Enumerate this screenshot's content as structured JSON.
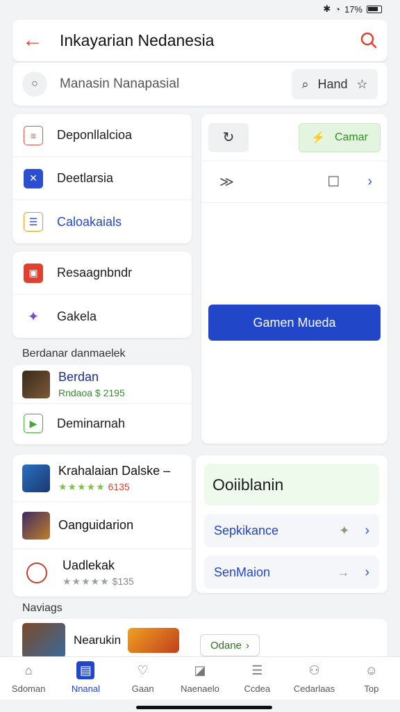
{
  "status": {
    "text": "17%"
  },
  "appbar": {
    "title": "Inkayarian Nedanesia"
  },
  "search": {
    "placeholder": "Manasin Nanapasial",
    "hand_label": "Hand"
  },
  "menu1": [
    {
      "label": "Deponllalcioa",
      "icon": "document-icon",
      "color": "#d9534f"
    },
    {
      "label": "Deetlarsia",
      "icon": "tools-icon",
      "color": "#2b4fd0"
    },
    {
      "label": "Caloakaials",
      "icon": "list-icon",
      "color": "#e0a020"
    }
  ],
  "menu2": [
    {
      "label": "Resaagnbndr",
      "icon": "gift-icon",
      "color": "#e0402f"
    },
    {
      "label": "Gakela",
      "icon": "pin-icon",
      "color": "#7a4fc0"
    }
  ],
  "section1": {
    "label": "Berdanar danmaelek"
  },
  "featured": {
    "name": "Berdan",
    "sub": "Rndaoa $ 2195",
    "link_label": "Deminarnah"
  },
  "apps": [
    {
      "name": "Krahalaian Dalske –",
      "rating_stars": "★★★★★",
      "rating_value": "6135",
      "style": "green",
      "rating": 5
    },
    {
      "name": "Oanguidarion",
      "rating_stars": "",
      "rating_value": "",
      "style": "none"
    },
    {
      "name": "Uadlekak",
      "rating_stars": "★★★★★",
      "rating_value": "$135",
      "style": "gray",
      "rating": 5
    }
  ],
  "right_panel": {
    "camar_label": "Camar",
    "primary_label": "Gamen Mueda"
  },
  "green_card": {
    "title": "Ooiiblanin",
    "rows": [
      {
        "label": "Sepkikance"
      },
      {
        "label": "SenMaion"
      }
    ]
  },
  "section2": {
    "label": "Naviags"
  },
  "bottom_card": {
    "name": "Nearukin",
    "button_label": "Odane"
  },
  "tabs": [
    {
      "label": "Sdoman",
      "icon": "home-icon",
      "active": false
    },
    {
      "label": "Nnanal",
      "icon": "grid-icon",
      "active": true
    },
    {
      "label": "Gaan",
      "icon": "heart-icon",
      "active": false
    },
    {
      "label": "Naenaelo",
      "icon": "message-icon",
      "active": false
    },
    {
      "label": "Ccdea",
      "icon": "bell-icon",
      "active": false
    },
    {
      "label": "Cedarlaas",
      "icon": "community-icon",
      "active": false
    },
    {
      "label": "Top",
      "icon": "profile-icon",
      "active": false
    }
  ]
}
